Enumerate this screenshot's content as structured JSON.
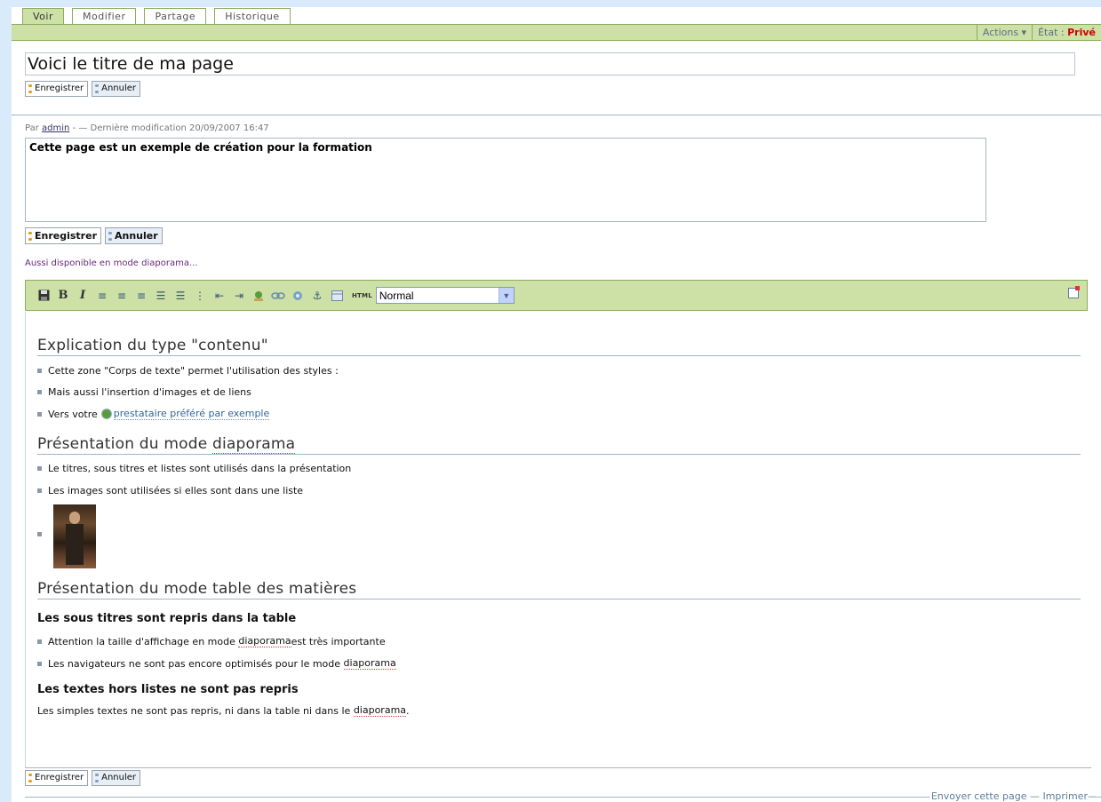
{
  "tabs": [
    {
      "label": "Voir",
      "active": true
    },
    {
      "label": "Modifier"
    },
    {
      "label": "Partage"
    },
    {
      "label": "Historique"
    }
  ],
  "actions_bar": {
    "actions_label": "Actions ▾",
    "state_label": "État :",
    "state_value": "Privé"
  },
  "title_field": {
    "value": "Voici le titre de ma page"
  },
  "buttons": {
    "save": "Enregistrer",
    "cancel": "Annuler"
  },
  "byline": {
    "prefix": "Par",
    "author": "admin",
    "suffix": "- — Dernière modification 20/09/2007 16:47"
  },
  "description": {
    "value": "Cette page est un exemple de création pour la formation"
  },
  "slideshow_link": "Aussi disponible en mode diaporama...",
  "toolbar": {
    "html_label": "HTML",
    "style_select": "Normal"
  },
  "content": {
    "h_contenu": "Explication du type \"contenu\"",
    "items1": [
      "Cette zone \"Corps de texte\" permet l'utilisation des styles :",
      "Mais aussi l'insertion d'images et de liens",
      "Vers votre"
    ],
    "link_text": "prestataire préféré par exemple",
    "h_diapo_pre": "Présentation du mode ",
    "h_diapo_word": "diaporama",
    "items2": [
      "Le titres, sous titres et listes sont utilisés dans la présentation",
      "Les images sont utilisées si elles sont dans une liste"
    ],
    "h_table": "Présentation du mode table des matières",
    "h3_a": "Les sous titres sont repris dans la table",
    "items3_a_pre": "Attention la taille d'affichage en mode ",
    "items3_a_word": "diaporama",
    "items3_a_post": " est très importante",
    "items3_b_pre": "Les navigateurs ne sont pas encore optimisés pour le mode ",
    "items3_b_word": "diaporama",
    "h3_b": "Les textes hors listes ne sont pas repris",
    "para_pre": "Les simples textes ne sont pas repris, ni dans la table ni dans le ",
    "para_word": "diaporama",
    "para_post": "."
  },
  "footer": {
    "send": "Envoyer cette page",
    "print": "Imprimer"
  }
}
